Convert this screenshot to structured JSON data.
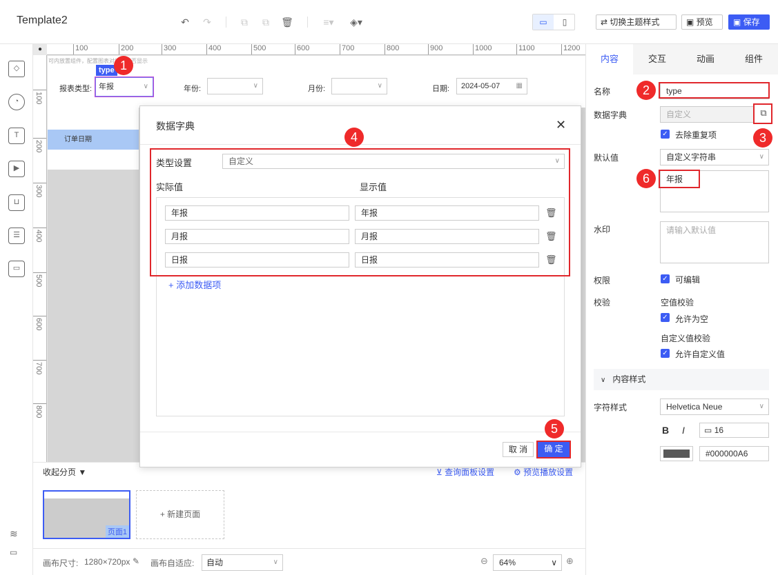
{
  "app": {
    "title": "Template2"
  },
  "toolbar": {
    "undo_icon": "undo-icon",
    "redo_icon": "redo-icon",
    "switch_theme_label": "切换主题样式",
    "preview_label": "预览",
    "save_label": "保存"
  },
  "ruler": {
    "top_ticks": [
      "100",
      "200",
      "300",
      "400",
      "500",
      "600",
      "700",
      "800",
      "900",
      "1000",
      "1100",
      "1200"
    ],
    "left_ticks": [
      "100",
      "200",
      "300",
      "400",
      "500",
      "600",
      "700",
      "800"
    ]
  },
  "canvas": {
    "hint": "可内放置组件，配置图表对组件是否显示",
    "type_badge": "type",
    "report_type_label": "报表类型:",
    "report_type_value": "年报",
    "year_label": "年份:",
    "month_label": "月份:",
    "date_label": "日期:",
    "date_value": "2024-05-07",
    "table_header": "订单日期"
  },
  "pages": {
    "collapse_label": "收起分页",
    "query_panel_label": "查询面板设置",
    "preview_play_label": "预览播放设置",
    "page1_label": "页面1",
    "new_page_label": "+ 新建页面"
  },
  "bottom": {
    "canvas_size_label": "画布尺寸:",
    "canvas_size_value": "1280×720px",
    "adapt_label": "画布自适应:",
    "adapt_value": "自动",
    "zoom_value": "64%"
  },
  "dialog": {
    "title": "数据字典",
    "type_setting_label": "类型设置",
    "type_setting_value": "自定义",
    "actual_header": "实际值",
    "display_header": "显示值",
    "rows": [
      {
        "actual": "年报",
        "display": "年报"
      },
      {
        "actual": "月报",
        "display": "月报"
      },
      {
        "actual": "日报",
        "display": "日报"
      }
    ],
    "add_item_label": "+ 添加数据项",
    "cancel_label": "取 消",
    "ok_label": "确 定"
  },
  "right_panel": {
    "tabs": [
      "内容",
      "交互",
      "动画",
      "组件"
    ],
    "name_label": "名称",
    "name_value": "type",
    "dict_label": "数据字典",
    "dict_value": "自定义",
    "dedupe_label": "去除重复项",
    "default_label": "默认值",
    "default_type": "自定义字符串",
    "default_value": "年报",
    "watermark_label": "水印",
    "watermark_placeholder": "请输入默认值",
    "permission_label": "权限",
    "editable_label": "可编辑",
    "validate_label": "校验",
    "null_check_label": "空值校验",
    "allow_null_label": "允许为空",
    "custom_check_label": "自定义值校验",
    "allow_custom_label": "允许自定义值",
    "content_style_label": "内容样式",
    "font_style_label": "字符样式",
    "font_value": "Helvetica Neue",
    "bold_label": "B",
    "italic_label": "I",
    "font_size": "16",
    "color_value": "#000000A6"
  },
  "annotations": [
    "1",
    "2",
    "3",
    "4",
    "5",
    "6"
  ],
  "colors": {
    "accent": "#3c5cf4",
    "annotation_red": "#ef2a2a",
    "table_header": "#a9c8f5"
  }
}
